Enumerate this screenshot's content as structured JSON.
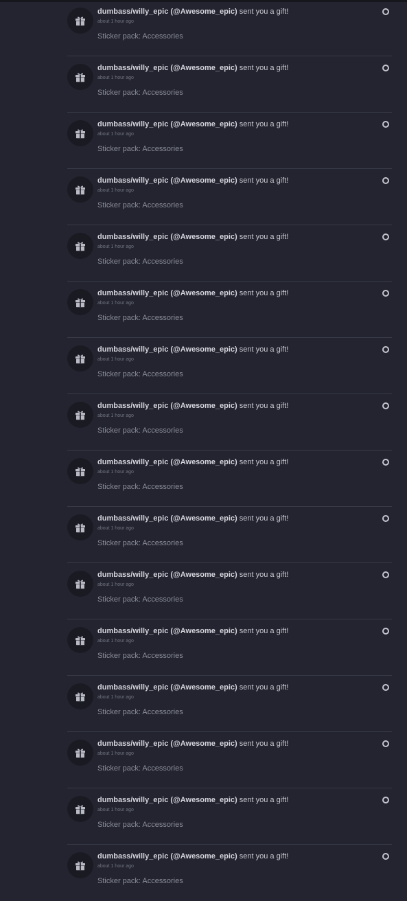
{
  "colors": {
    "background": "#23242f",
    "divider": "#383a47",
    "avatar_bg": "#191a22",
    "title_text": "#c9cad3",
    "muted_text": "#8b8d9a"
  },
  "notifications": [
    {
      "user": "dumbass/willy_epic (@Awesome_epic)",
      "action": " sent you a gift!",
      "time": "about 1 hour ago",
      "detail": "Sticker pack: Accessories",
      "icon": "gift-icon",
      "status_icon": "unread-dot-icon"
    },
    {
      "user": "dumbass/willy_epic (@Awesome_epic)",
      "action": " sent you a gift!",
      "time": "about 1 hour ago",
      "detail": "Sticker pack: Accessories",
      "icon": "gift-icon",
      "status_icon": "unread-dot-icon"
    },
    {
      "user": "dumbass/willy_epic (@Awesome_epic)",
      "action": " sent you a gift!",
      "time": "about 1 hour ago",
      "detail": "Sticker pack: Accessories",
      "icon": "gift-icon",
      "status_icon": "unread-dot-icon"
    },
    {
      "user": "dumbass/willy_epic (@Awesome_epic)",
      "action": " sent you a gift!",
      "time": "about 1 hour ago",
      "detail": "Sticker pack: Accessories",
      "icon": "gift-icon",
      "status_icon": "unread-dot-icon"
    },
    {
      "user": "dumbass/willy_epic (@Awesome_epic)",
      "action": " sent you a gift!",
      "time": "about 1 hour ago",
      "detail": "Sticker pack: Accessories",
      "icon": "gift-icon",
      "status_icon": "unread-dot-icon"
    },
    {
      "user": "dumbass/willy_epic (@Awesome_epic)",
      "action": " sent you a gift!",
      "time": "about 1 hour ago",
      "detail": "Sticker pack: Accessories",
      "icon": "gift-icon",
      "status_icon": "unread-dot-icon"
    },
    {
      "user": "dumbass/willy_epic (@Awesome_epic)",
      "action": " sent you a gift!",
      "time": "about 1 hour ago",
      "detail": "Sticker pack: Accessories",
      "icon": "gift-icon",
      "status_icon": "unread-dot-icon"
    },
    {
      "user": "dumbass/willy_epic (@Awesome_epic)",
      "action": " sent you a gift!",
      "time": "about 1 hour ago",
      "detail": "Sticker pack: Accessories",
      "icon": "gift-icon",
      "status_icon": "unread-dot-icon"
    },
    {
      "user": "dumbass/willy_epic (@Awesome_epic)",
      "action": " sent you a gift!",
      "time": "about 1 hour ago",
      "detail": "Sticker pack: Accessories",
      "icon": "gift-icon",
      "status_icon": "unread-dot-icon"
    },
    {
      "user": "dumbass/willy_epic (@Awesome_epic)",
      "action": " sent you a gift!",
      "time": "about 1 hour ago",
      "detail": "Sticker pack: Accessories",
      "icon": "gift-icon",
      "status_icon": "unread-dot-icon"
    },
    {
      "user": "dumbass/willy_epic (@Awesome_epic)",
      "action": " sent you a gift!",
      "time": "about 1 hour ago",
      "detail": "Sticker pack: Accessories",
      "icon": "gift-icon",
      "status_icon": "unread-dot-icon"
    },
    {
      "user": "dumbass/willy_epic (@Awesome_epic)",
      "action": " sent you a gift!",
      "time": "about 1 hour ago",
      "detail": "Sticker pack: Accessories",
      "icon": "gift-icon",
      "status_icon": "unread-dot-icon"
    },
    {
      "user": "dumbass/willy_epic (@Awesome_epic)",
      "action": " sent you a gift!",
      "time": "about 1 hour ago",
      "detail": "Sticker pack: Accessories",
      "icon": "gift-icon",
      "status_icon": "unread-dot-icon"
    },
    {
      "user": "dumbass/willy_epic (@Awesome_epic)",
      "action": " sent you a gift!",
      "time": "about 1 hour ago",
      "detail": "Sticker pack: Accessories",
      "icon": "gift-icon",
      "status_icon": "unread-dot-icon"
    },
    {
      "user": "dumbass/willy_epic (@Awesome_epic)",
      "action": " sent you a gift!",
      "time": "about 1 hour ago",
      "detail": "Sticker pack: Accessories",
      "icon": "gift-icon",
      "status_icon": "unread-dot-icon"
    },
    {
      "user": "dumbass/willy_epic (@Awesome_epic)",
      "action": " sent you a gift!",
      "time": "about 1 hour ago",
      "detail": "Sticker pack: Accessories",
      "icon": "gift-icon",
      "status_icon": "unread-dot-icon"
    }
  ]
}
